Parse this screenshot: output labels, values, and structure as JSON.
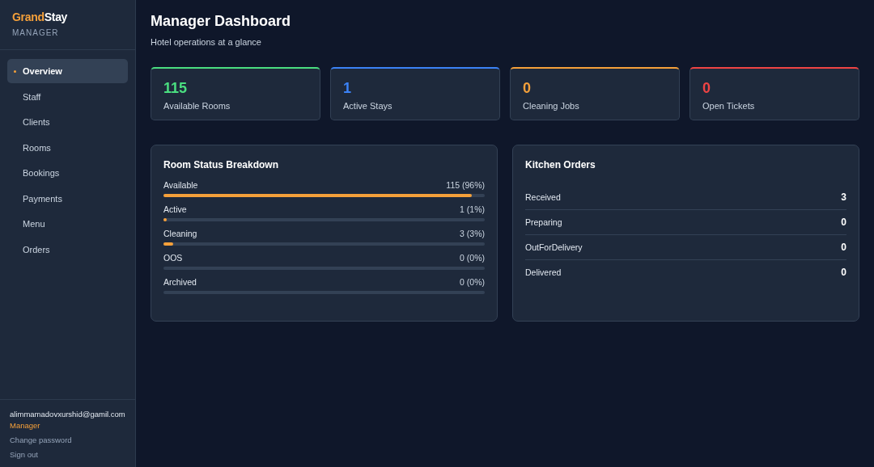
{
  "sidebar": {
    "logo": [
      {
        "text": "Grand",
        "color": "#f5a03a"
      },
      {
        "text": "Stay",
        "color": "#ffffff"
      }
    ],
    "role_caption": "MANAGER",
    "items": [
      {
        "label": "Overview",
        "selected": true
      },
      {
        "label": "Staff",
        "selected": false
      },
      {
        "label": "Clients",
        "selected": false
      },
      {
        "label": "Rooms",
        "selected": false
      },
      {
        "label": "Bookings",
        "selected": false
      },
      {
        "label": "Payments",
        "selected": false
      },
      {
        "label": "Menu",
        "selected": false
      },
      {
        "label": "Orders",
        "selected": false
      }
    ],
    "user": {
      "email": "alimmamadovxurshid@gamil.com",
      "role": "Manager",
      "links": [
        "Change password",
        "Sign out"
      ]
    }
  },
  "header": {
    "title": "Manager Dashboard",
    "subtitle": "Hotel operations at a glance"
  },
  "stats": [
    {
      "value": "115",
      "label": "Available Rooms",
      "color": "#4ade80"
    },
    {
      "value": "1",
      "label": "Active Stays",
      "color": "#3b82f6"
    },
    {
      "value": "0",
      "label": "Cleaning Jobs",
      "color": "#f5a03a"
    },
    {
      "value": "0",
      "label": "Open Tickets",
      "color": "#ef4444"
    }
  ],
  "room_status": {
    "title": "Room Status Breakdown",
    "rows": [
      {
        "label": "Available",
        "reading": "115 (96%)",
        "level": 0.96
      },
      {
        "label": "Active",
        "reading": "1 (1%)",
        "level": 0.01
      },
      {
        "label": "Cleaning",
        "reading": "3 (3%)",
        "level": 0.03
      },
      {
        "label": "OOS",
        "reading": "0 (0%)"
      },
      {
        "label": "Archived",
        "reading": "0 (0%)"
      }
    ]
  },
  "kitchen_orders": {
    "title": "Kitchen Orders",
    "rows": [
      {
        "label": "Received",
        "value": "3"
      },
      {
        "label": "Preparing",
        "value": "0"
      },
      {
        "label": "OutForDelivery",
        "value": "0"
      },
      {
        "label": "Delivered",
        "value": "0"
      }
    ]
  }
}
